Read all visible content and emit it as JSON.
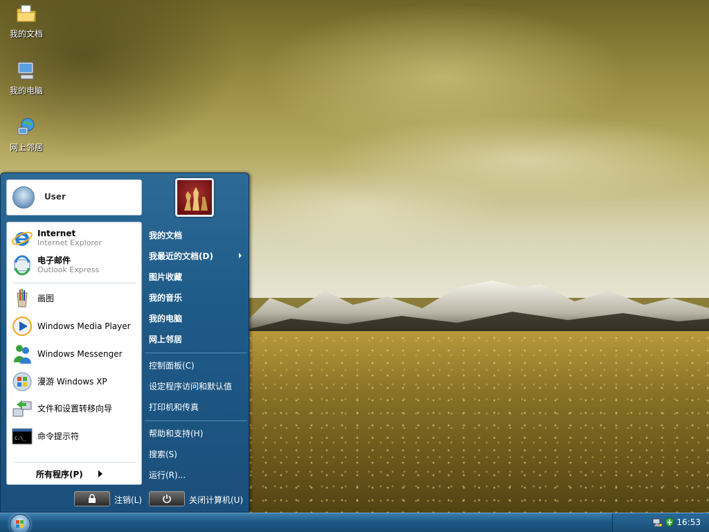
{
  "desktop": {
    "icons": [
      {
        "label": "我的文档",
        "icon": "folder-document-icon"
      },
      {
        "label": "我的电脑",
        "icon": "computer-icon"
      },
      {
        "label": "网上邻居",
        "icon": "network-places-icon"
      }
    ]
  },
  "start_menu": {
    "user_name": "User",
    "pinned": [
      {
        "title": "Internet",
        "subtitle": "Internet Explorer",
        "icon": "internet-explorer-icon"
      },
      {
        "title": "电子邮件",
        "subtitle": "Outlook Express",
        "icon": "outlook-express-icon"
      }
    ],
    "recent": [
      {
        "title": "画图",
        "icon": "paint-icon"
      },
      {
        "title": "Windows Media Player",
        "icon": "media-player-icon"
      },
      {
        "title": "Windows Messenger",
        "icon": "messenger-icon"
      },
      {
        "title": "漫游 Windows XP",
        "icon": "tour-xp-icon"
      },
      {
        "title": "文件和设置转移向导",
        "icon": "transfer-wizard-icon"
      },
      {
        "title": "命令提示符",
        "icon": "command-prompt-icon"
      }
    ],
    "cmd_glyph": "C:\\_",
    "all_programs": "所有程序(P)",
    "right_items": [
      {
        "label": "我的文档",
        "bold": true
      },
      {
        "label": "我最近的文档(D)",
        "bold": true,
        "submenu": true
      },
      {
        "label": "图片收藏",
        "bold": true
      },
      {
        "label": "我的音乐",
        "bold": true
      },
      {
        "label": "我的电脑",
        "bold": true
      },
      {
        "label": "网上邻居",
        "bold": true
      },
      {
        "label": "控制面板(C)",
        "bold": false
      },
      {
        "label": "设定程序访问和默认值",
        "bold": false
      },
      {
        "label": "打印机和传真",
        "bold": false
      },
      {
        "label": "帮助和支持(H)",
        "bold": false
      },
      {
        "label": "搜索(S)",
        "bold": false
      },
      {
        "label": "运行(R)...",
        "bold": false
      }
    ],
    "logoff_label": "注销(L)",
    "shutdown_label": "关闭计算机(U)"
  },
  "taskbar": {
    "clock": "16:53",
    "tray_icons": [
      "keyboard-icon",
      "network-icon",
      "security-shield-icon"
    ]
  },
  "colors": {
    "menu_blue": "#1e5a88",
    "taskbar_blue": "#1d5a88",
    "separator": "#d0d8e0"
  }
}
